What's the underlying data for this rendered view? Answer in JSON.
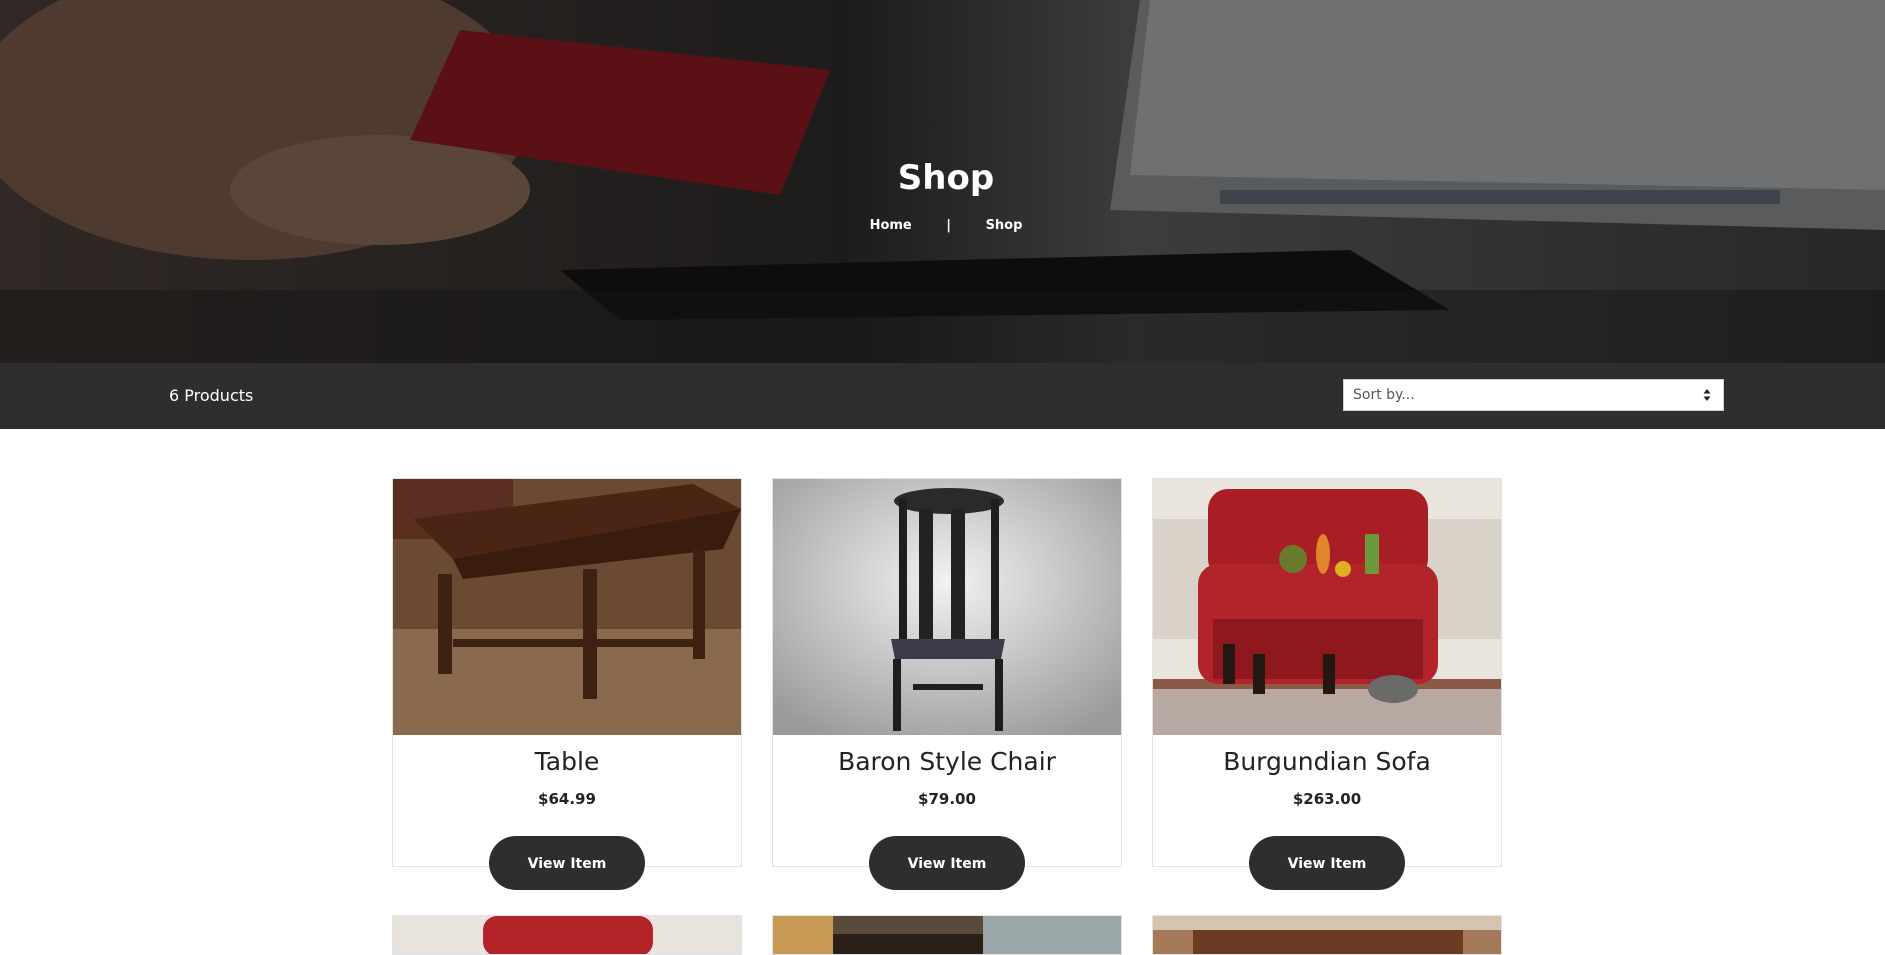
{
  "hero": {
    "title": "Shop",
    "breadcrumb": {
      "home": "Home",
      "separator": "|",
      "current": "Shop"
    }
  },
  "toolbar": {
    "product_count": "6 Products",
    "sort_select": {
      "selected": "Sort by..."
    }
  },
  "products": [
    {
      "name": "Table",
      "price": "$64.99",
      "button": "View Item"
    },
    {
      "name": "Baron Style Chair",
      "price": "$79.00",
      "button": "View Item"
    },
    {
      "name": "Burgundian Sofa",
      "price": "$263.00",
      "button": "View Item"
    }
  ],
  "colors": {
    "toolbar_bg": "#2e2e30",
    "button_bg": "#2e2e30",
    "text_dark": "#222222"
  }
}
